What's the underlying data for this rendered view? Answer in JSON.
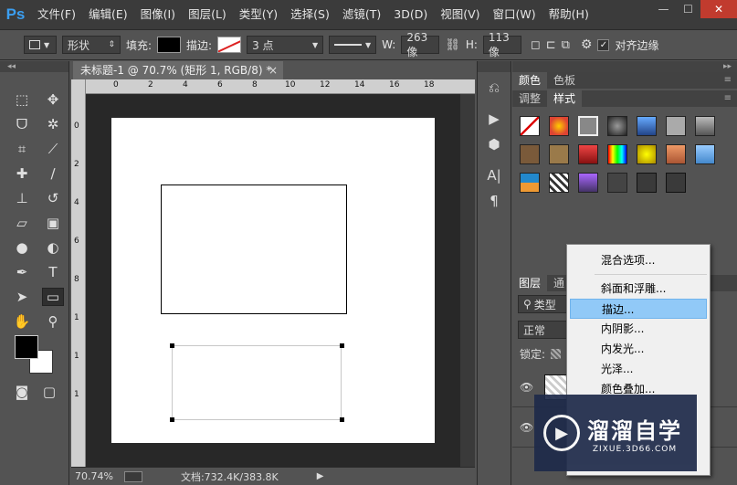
{
  "app": {
    "logo": "Ps"
  },
  "menu": [
    "文件(F)",
    "编辑(E)",
    "图像(I)",
    "图层(L)",
    "类型(Y)",
    "选择(S)",
    "滤镜(T)",
    "3D(D)",
    "视图(V)",
    "窗口(W)",
    "帮助(H)"
  ],
  "window_controls": {
    "minimize": "—",
    "maximize": "☐",
    "close": "✕"
  },
  "options": {
    "mode": "形状",
    "fill_label": "填充:",
    "stroke_label": "描边:",
    "stroke_width": "3 点",
    "w_label": "W:",
    "w_value": "263 像",
    "h_label": "H:",
    "h_value": "113 像",
    "align_edges": "对齐边缘"
  },
  "document": {
    "tab_title": "未标题-1 @ 70.7% (矩形 1, RGB/8) *",
    "ruler_top": [
      "0",
      "2",
      "4",
      "6",
      "8",
      "10",
      "12",
      "14",
      "16",
      "18"
    ],
    "ruler_left": [
      "0",
      "2",
      "4",
      "6",
      "8",
      "1",
      "1",
      "1"
    ]
  },
  "status": {
    "zoom": "70.74%",
    "doc_info": "文档:732.4K/383.8K"
  },
  "panels": {
    "top_tabs": [
      "颜色",
      "色板"
    ],
    "style_tabs": [
      "调整",
      "样式"
    ],
    "layers_tabs": [
      "图层",
      "通"
    ],
    "layers_filter": "类型",
    "blend_mode": "正常",
    "lock_label": "锁定:"
  },
  "context_menu": {
    "items": [
      "混合选项...",
      "斜面和浮雕...",
      "描边...",
      "内阴影...",
      "内发光...",
      "光泽...",
      "颜色叠加..."
    ],
    "highlighted_index": 2
  },
  "watermark": {
    "title": "溜溜自学",
    "sub": "ZIXUE.3D66.COM"
  },
  "colors": {
    "accent": "#3b9ef0",
    "highlight": "#91c9f7",
    "close": "#c13b2e"
  }
}
